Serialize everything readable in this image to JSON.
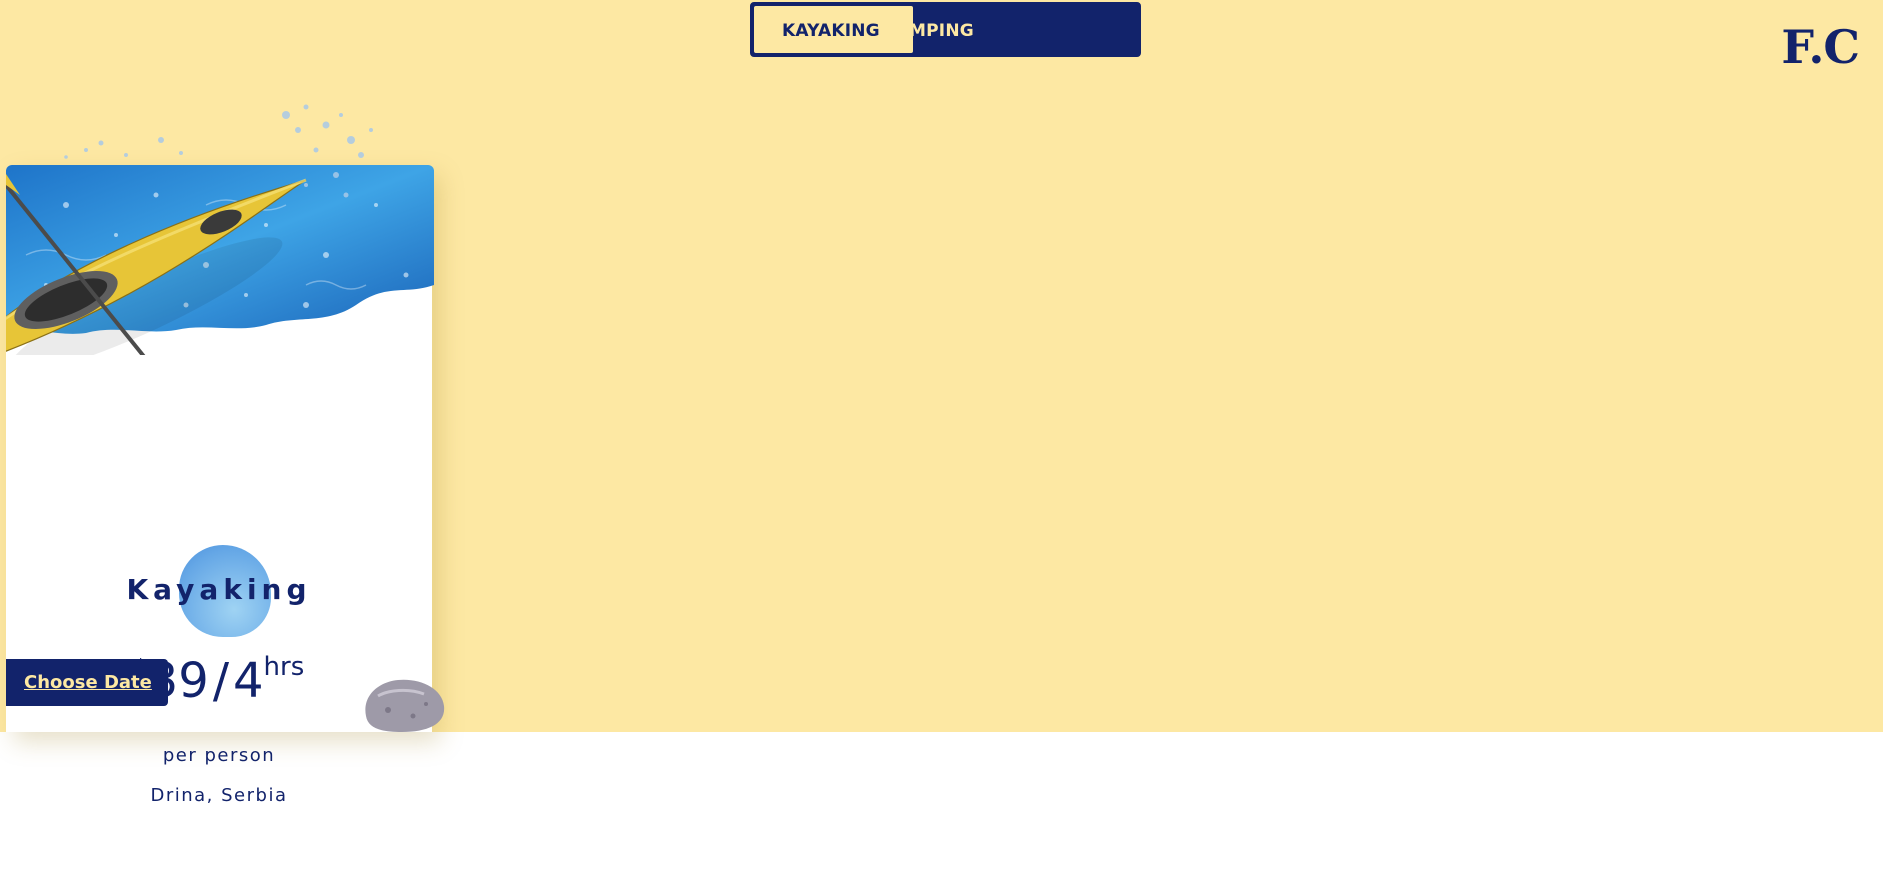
{
  "tabs": {
    "kayaking": "KAYAKING",
    "camping": "CAMPING",
    "active": "kayaking"
  },
  "logo": "F.C",
  "card": {
    "title": "Kayaking",
    "price": {
      "currency": "$",
      "amount": "39",
      "separator": "/",
      "duration": "4",
      "unit": "hrs"
    },
    "per_person": "per person",
    "location": "Drina, Serbia",
    "cta_label": "Choose Date"
  },
  "colors": {
    "background": "#fde8a3",
    "navy": "#12236b",
    "card": "#ffffff",
    "water": "#2f8fd8",
    "kayak": "#e8c53a"
  },
  "icons": {
    "kayak_image": "kayak-image",
    "splash_image": "water-splash-image",
    "rock_image": "rock-image",
    "blob": "blue-blob-shape"
  }
}
